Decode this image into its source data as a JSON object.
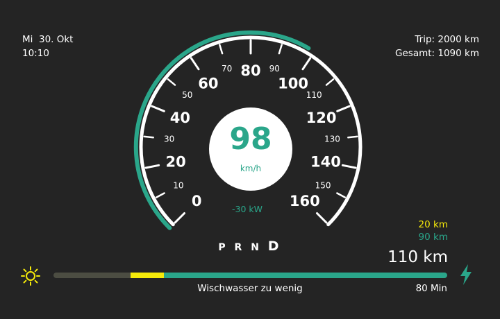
{
  "status": {
    "date": "Mi  30. Okt",
    "time": "10:10",
    "trip": "Trip: 2000 km",
    "total": "Gesamt: 1090 km"
  },
  "speedometer": {
    "speed": "98",
    "unit": "km/h",
    "power": "-30 kW",
    "major_ticks": [
      "0",
      "20",
      "40",
      "60",
      "80",
      "100",
      "120",
      "140",
      "160"
    ],
    "minor_ticks": [
      "10",
      "30",
      "50",
      "70",
      "90",
      "110",
      "130",
      "150"
    ],
    "min": 0,
    "max": 160,
    "value": 98,
    "accent": "#2aa68a"
  },
  "gears": {
    "p": "P",
    "r": "R",
    "n": "N",
    "d": "D",
    "active": "D"
  },
  "range": {
    "yellow": "20 km",
    "green": "90 km",
    "total": "110 km",
    "yellow_color": "#f5ea0a",
    "green_color": "#2aa68a"
  },
  "battery_bar": {
    "warning": "Wischwasser zu wenig",
    "time_left": "80 Min",
    "left_icon": "sun-icon",
    "right_icon": "lightning-icon"
  }
}
